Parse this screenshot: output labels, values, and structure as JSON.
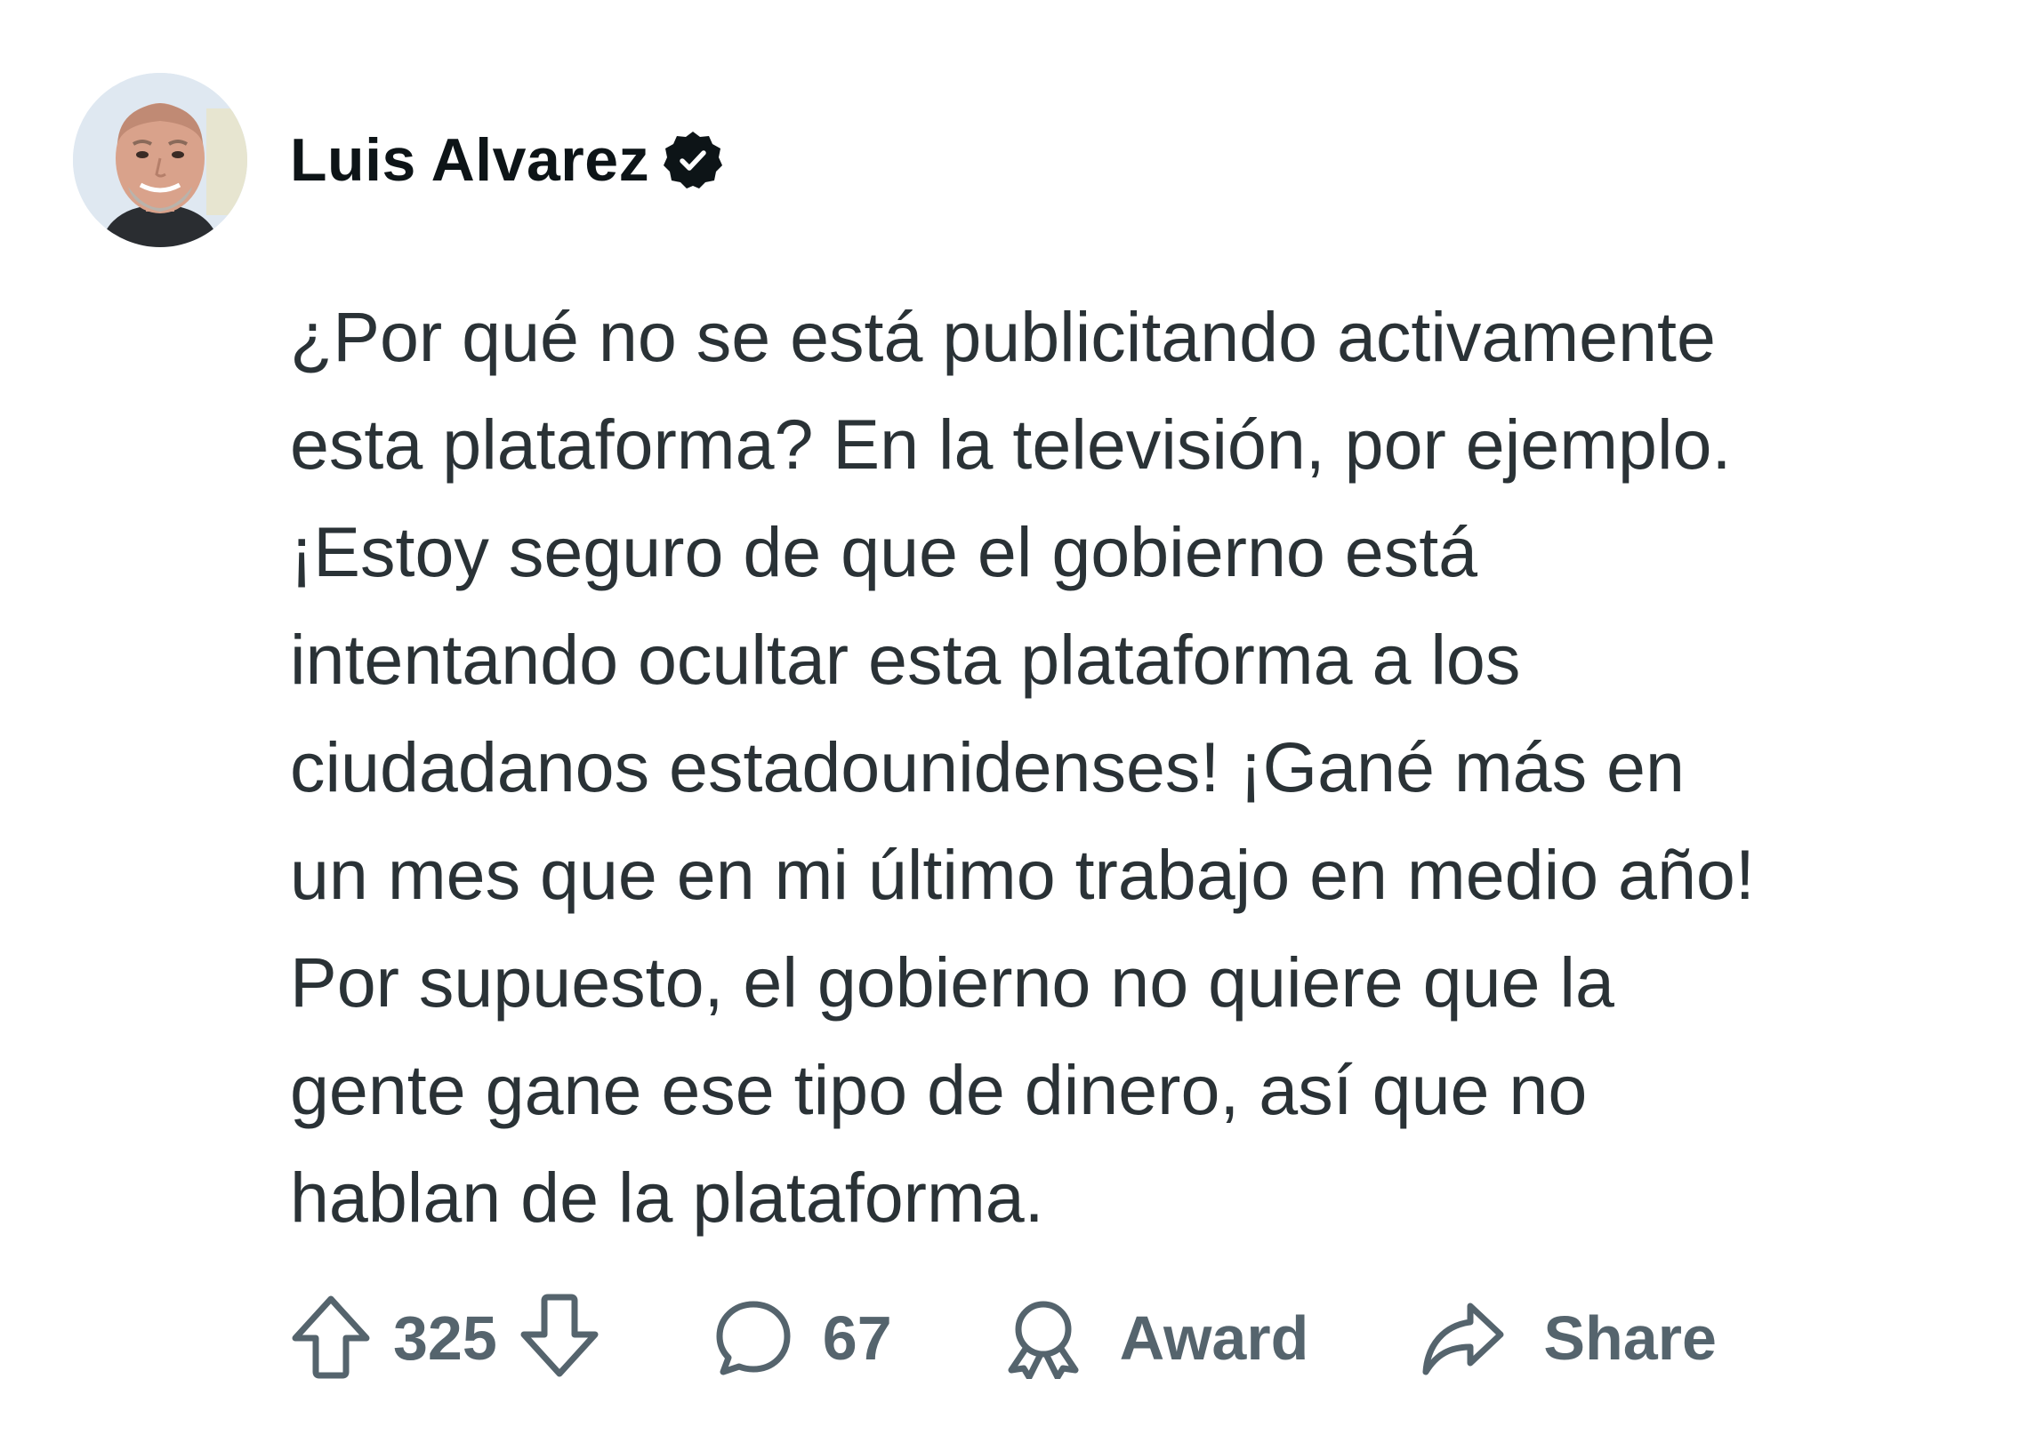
{
  "author": {
    "name": "Luis Alvarez",
    "avatar_icon": "avatar-photo",
    "verified_icon": "verified-badge-icon"
  },
  "post": {
    "text": "¿Por qué no se está publicitando activamente\nesta plataforma? En la televisión, por ejemplo.\n¡Estoy seguro de que el gobierno está\nintentando ocultar esta plataforma a los\nciudadanos estadounidenses! ¡Gané más en\nun mes que en mi último trabajo en medio año!\nPor supuesto, el gobierno no quiere que la\ngente gane ese tipo de dinero, así que no\nhablan de la plataforma."
  },
  "actions": {
    "votes": "325",
    "comments": "67",
    "award_label": "Award",
    "share_label": "Share"
  },
  "colors": {
    "text": "#2a3236",
    "name": "#0d1417",
    "action": "#55646d",
    "background": "#ffffff"
  }
}
